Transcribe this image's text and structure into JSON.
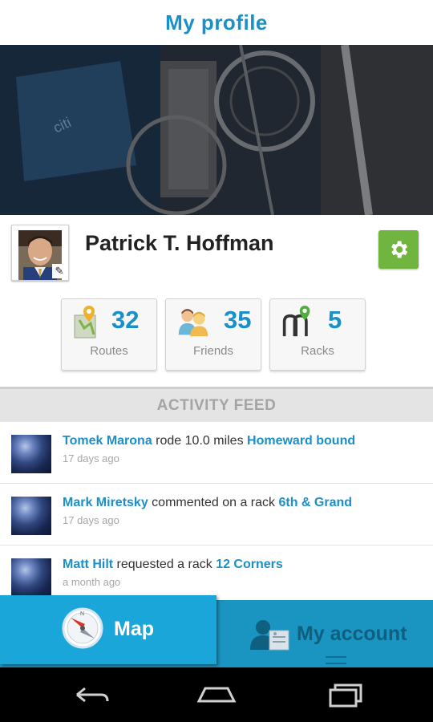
{
  "header": {
    "title": "My profile"
  },
  "profile": {
    "name": "Patrick T. Hoffman",
    "avatar_icon": "user-photo",
    "edit_icon": "pencil-icon",
    "settings_icon": "gear-icon"
  },
  "stats": [
    {
      "count": "32",
      "label": "Routes",
      "icon": "routes-icon"
    },
    {
      "count": "35",
      "label": "Friends",
      "icon": "friends-icon"
    },
    {
      "count": "5",
      "label": "Racks",
      "icon": "rack-icon"
    }
  ],
  "feed": {
    "title": "ACTIVITY FEED",
    "items": [
      {
        "user": "Tomek Marona",
        "action": " rode 10.0 miles ",
        "target": "Homeward bound",
        "time": "17 days ago"
      },
      {
        "user": "Mark Miretsky",
        "action": " commented on a rack ",
        "target": "6th & Grand",
        "time": "17 days ago"
      },
      {
        "user": "Matt Hilt",
        "action": " requested a rack ",
        "target": "12 Corners",
        "time": "a month ago"
      }
    ]
  },
  "tabs": {
    "map": {
      "label": "Map",
      "icon": "compass-icon"
    },
    "account": {
      "label": "My account",
      "icon": "account-icon"
    }
  },
  "system_nav": {
    "back_icon": "back-icon",
    "home_icon": "home-icon",
    "recents_icon": "recents-icon"
  },
  "colors": {
    "accent": "#1b8fc7",
    "settings_green": "#6fb53f",
    "tab_active": "#1ba6d9",
    "tab_bar": "#1a94c0"
  }
}
